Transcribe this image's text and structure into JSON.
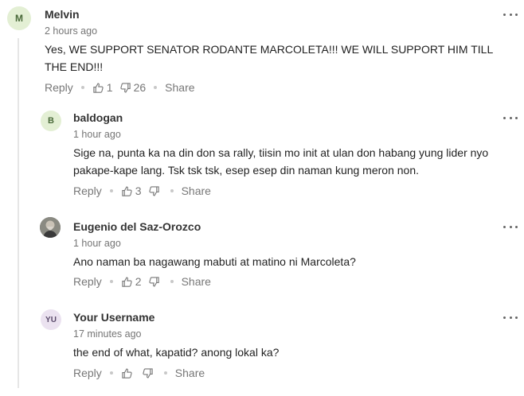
{
  "comments": [
    {
      "avatar_initial": "M",
      "avatar_bg": "#e3efd4",
      "avatar_fg": "#4a6a3a",
      "author": "Melvin",
      "time": "2 hours ago",
      "text": "Yes, WE SUPPORT SENATOR RODANTE MARCOLETA!!! WE WILL SUPPORT HIM TILL THE END!!!",
      "reply_label": "Reply",
      "upvotes": "1",
      "downvotes": "26",
      "share_label": "Share"
    },
    {
      "avatar_initial": "B",
      "avatar_bg": "#e3efd4",
      "avatar_fg": "#4a6a3a",
      "author": "baldogan",
      "time": "1 hour ago",
      "text": "Sige na, punta ka na din don sa rally, tiisin mo init at ulan don habang yung lider nyo pakape-kape lang. Tsk tsk tsk, esep esep din naman kung meron non.",
      "reply_label": "Reply",
      "upvotes": "3",
      "downvotes": "",
      "share_label": "Share"
    },
    {
      "avatar_initial": "",
      "avatar_bg": "#6b6b6b",
      "avatar_fg": "#ffffff",
      "author": "Eugenio del Saz-Orozco",
      "time": "1 hour ago",
      "text": "Ano naman ba nagawang mabuti at matino ni Marcoleta?",
      "reply_label": "Reply",
      "upvotes": "2",
      "downvotes": "",
      "share_label": "Share"
    },
    {
      "avatar_initial": "YU",
      "avatar_bg": "#ebe2f0",
      "avatar_fg": "#5a4a6a",
      "author": "Your Username",
      "time": "17 minutes ago",
      "text": "the end of what, kapatid? anong lokal ka?",
      "reply_label": "Reply",
      "upvotes": "",
      "downvotes": "",
      "share_label": "Share"
    }
  ],
  "icons": {
    "upvote": "thumbs-up-icon",
    "downvote": "thumbs-down-icon",
    "more": "more-options-icon"
  }
}
